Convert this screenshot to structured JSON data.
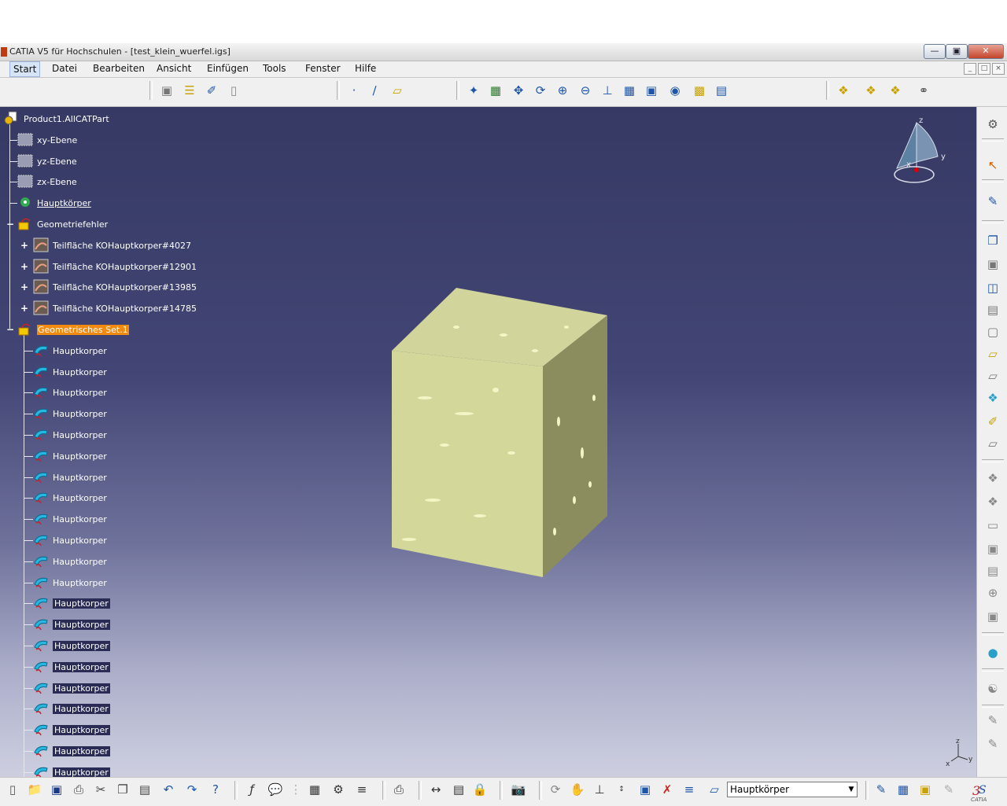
{
  "window": {
    "title": "CATIA V5 für Hochschulen - [test_klein_wuerfel.igs]",
    "buttons": [
      "minimize-icon",
      "maximize-icon",
      "close-icon"
    ]
  },
  "menu": [
    "Start",
    "Datei",
    "Bearbeiten",
    "Ansicht",
    "Einfügen",
    "Tools",
    "Fenster",
    "Hilfe"
  ],
  "tree": {
    "root": "Product1.AllCATPart",
    "planes": [
      "xy-Ebene",
      "yz-Ebene",
      "zx-Ebene"
    ],
    "body": "Hauptkörper",
    "errors_group": "Geometriefehler",
    "errors": [
      "Teilfläche KOHauptkorper#4027",
      "Teilfläche KOHauptkorper#12901",
      "Teilfläche KOHauptkorper#13985",
      "Teilfläche KOHauptkorper#14785"
    ],
    "set": "Geometrisches Set.1",
    "set_items": [
      "Hauptkorper",
      "Hauptkorper",
      "Hauptkorper",
      "Hauptkorper",
      "Hauptkorper",
      "Hauptkorper",
      "Hauptkorper",
      "Hauptkorper",
      "Hauptkorper",
      "Hauptkorper",
      "Hauptkorper",
      "Hauptkorper",
      "Hauptkorper",
      "Hauptkorper",
      "Hauptkorper",
      "Hauptkorper",
      "Hauptkorper",
      "Hauptkorper",
      "Hauptkorper",
      "Hauptkorper",
      "Hauptkorper",
      "Hauptkorper"
    ]
  },
  "compass": {
    "x": "x",
    "y": "y",
    "z": "z"
  },
  "axes": {
    "x": "x",
    "y": "y",
    "z": "z"
  },
  "bottom": {
    "combo_value": "Hauptkörper",
    "logo": "CATIA"
  },
  "colors": {
    "viewport_top": "#353963",
    "viewport_bottom": "#cdcfe0",
    "cube_face": "#d4d79a",
    "selection": "#f08a10"
  }
}
